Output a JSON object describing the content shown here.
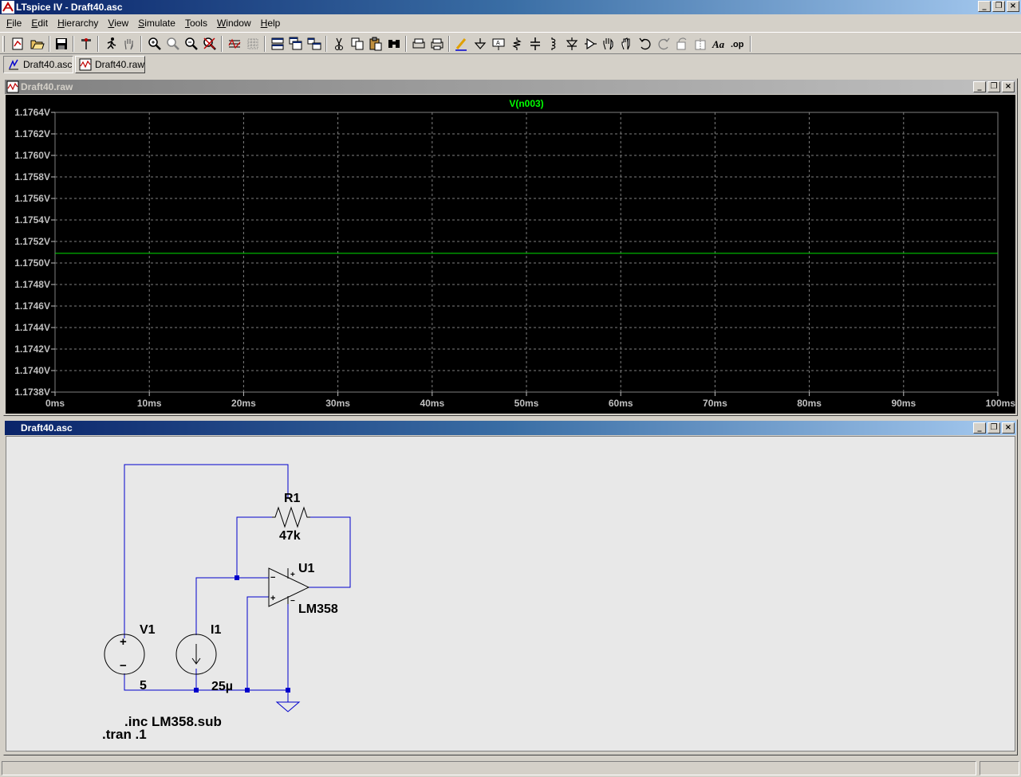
{
  "app": {
    "title": "LTspice IV - Draft40.asc",
    "colors": {
      "titlebar": "#0a246a",
      "trace": "#00e000",
      "trace_label": "#00ff00",
      "wire": "#0000cc",
      "node": "#0000cc",
      "grid": "#808080",
      "axis_text": "#c0c0c0",
      "schematic_bg": "#e8e8e8"
    }
  },
  "window_buttons": {
    "minimize": "_",
    "restore": "❐",
    "close": "×"
  },
  "menu": [
    {
      "label": "File",
      "underline": "F",
      "rest": "ile"
    },
    {
      "label": "Edit",
      "underline": "E",
      "rest": "dit"
    },
    {
      "label": "Hierarchy",
      "underline": "H",
      "rest": "ierarchy"
    },
    {
      "label": "View",
      "underline": "V",
      "rest": "iew"
    },
    {
      "label": "Simulate",
      "underline": "S",
      "rest": "imulate"
    },
    {
      "label": "Tools",
      "underline": "T",
      "rest": "ools"
    },
    {
      "label": "Window",
      "underline": "W",
      "rest": "indow"
    },
    {
      "label": "Help",
      "underline": "H",
      "rest": "elp"
    }
  ],
  "toolbar": {
    "icons": [
      "new-schematic-icon",
      "open-icon",
      "save-icon",
      "control-panel-icon",
      "run-icon",
      "pan-icon",
      "zoom-in-icon",
      "zoom-fit-icon",
      "zoom-out-icon",
      "zoom-cancel-icon",
      "autorange-icon",
      "grid-icon",
      "tile-horizontal-icon",
      "cascade-icon",
      "tile-vertical-icon",
      "cut-icon",
      "copy-icon",
      "paste-icon",
      "find-icon",
      "print-setup-icon",
      "print-icon",
      "draw-wire-icon",
      "ground-icon",
      "label-net-icon",
      "resistor-icon",
      "capacitor-icon",
      "inductor-icon",
      "diode-icon",
      "component-icon",
      "move-icon",
      "drag-icon",
      "undo-icon",
      "redo-icon",
      "rotate-icon",
      "mirror-icon",
      "text-icon",
      "spice-directive-icon"
    ]
  },
  "tabs": [
    {
      "label": "Draft40.asc",
      "icon": "schematic-icon",
      "active": true
    },
    {
      "label": "Draft40.raw",
      "icon": "waveform-icon",
      "active": false
    }
  ],
  "waveform_window": {
    "title": "Draft40.raw"
  },
  "schematic_window": {
    "title": "Draft40.asc"
  },
  "chart_data": {
    "type": "line",
    "title": "V(n003)",
    "xlabel": "",
    "ylabel": "",
    "x_ticks": [
      "0ms",
      "10ms",
      "20ms",
      "30ms",
      "40ms",
      "50ms",
      "60ms",
      "70ms",
      "80ms",
      "90ms",
      "100ms"
    ],
    "y_ticks": [
      "1.1764V",
      "1.1762V",
      "1.1760V",
      "1.1758V",
      "1.1756V",
      "1.1754V",
      "1.1752V",
      "1.1750V",
      "1.1748V",
      "1.1746V",
      "1.1744V",
      "1.1742V",
      "1.1740V",
      "1.1738V"
    ],
    "xlim": [
      0,
      100
    ],
    "ylim": [
      1.1738,
      1.1764
    ],
    "grid": true,
    "series": [
      {
        "name": "V(n003)",
        "x": [
          0,
          100
        ],
        "values": [
          1.17509,
          1.17509
        ]
      }
    ]
  },
  "schematic": {
    "components": {
      "r1_name": "R1",
      "r1_value": "47k",
      "u1_name": "U1",
      "u1_value": "LM358",
      "v1_name": "V1",
      "v1_value": "5",
      "i1_name": "I1",
      "i1_value": "25µ",
      "opamp_minus": "−",
      "opamp_plus": "+",
      "opamp_minus2": "−",
      "opamp_plus2": "+",
      "v1_plus": "+",
      "v1_minus": "−"
    },
    "directives": [
      ".inc LM358.sub",
      ".tran .1"
    ]
  },
  "status": {
    "text": ""
  }
}
